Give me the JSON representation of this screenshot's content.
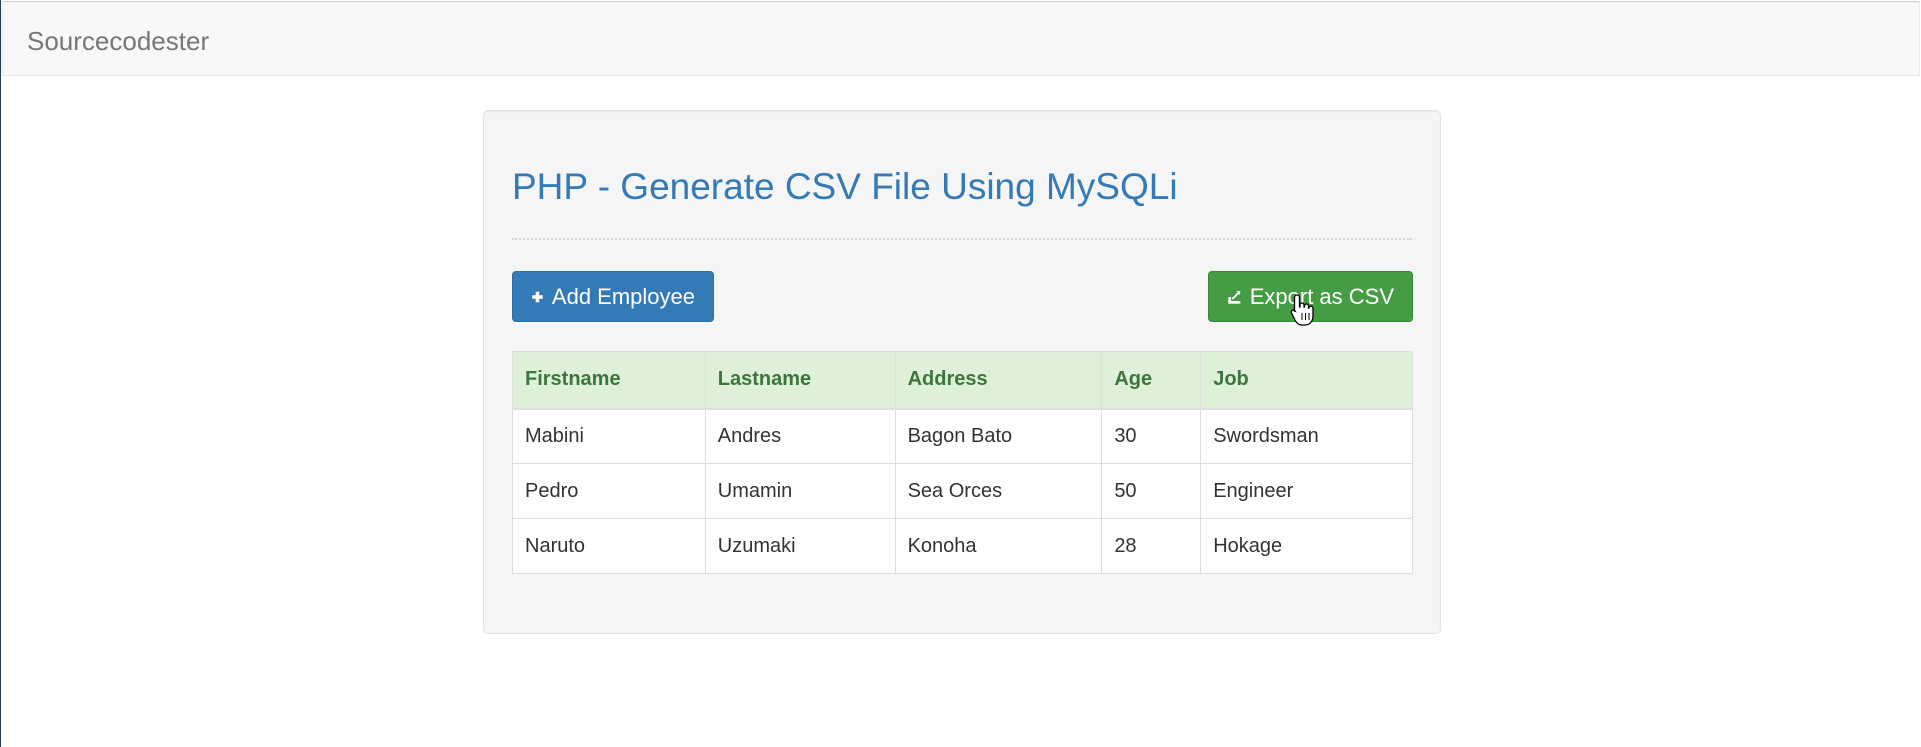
{
  "navbar": {
    "brand": "Sourcecodester"
  },
  "main": {
    "title": "PHP - Generate CSV File Using MySQLi",
    "add_button": {
      "label": "Add Employee",
      "icon": "plus-icon"
    },
    "export_button": {
      "label": "Export as CSV",
      "icon": "export-icon"
    },
    "table": {
      "columns": [
        "Firstname",
        "Lastname",
        "Address",
        "Age",
        "Job"
      ],
      "rows": [
        [
          "Mabini",
          "Andres",
          "Bagon Bato",
          "30",
          "Swordsman"
        ],
        [
          "Pedro",
          "Umamin",
          "Sea Orces",
          "50",
          "Engineer"
        ],
        [
          "Naruto",
          "Uzumaki",
          "Konoha",
          "28",
          "Hokage"
        ]
      ]
    }
  },
  "colors": {
    "primary": "#337ab7",
    "success": "#449d44",
    "table_header_bg": "#dff0d8",
    "table_header_text": "#3c763d",
    "navbar_bg": "#f8f8f8"
  }
}
